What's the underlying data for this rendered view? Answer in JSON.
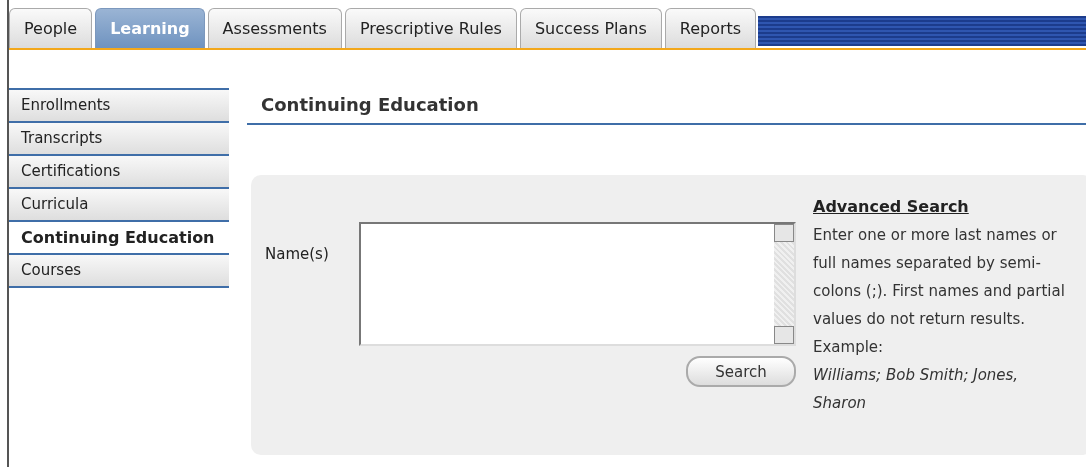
{
  "tabs": [
    {
      "label": "People",
      "selected": false
    },
    {
      "label": "Learning",
      "selected": true
    },
    {
      "label": "Assessments",
      "selected": false
    },
    {
      "label": "Prescriptive Rules",
      "selected": false
    },
    {
      "label": "Success Plans",
      "selected": false
    },
    {
      "label": "Reports",
      "selected": false
    }
  ],
  "sidebar": {
    "items": [
      {
        "label": "Enrollments",
        "selected": false
      },
      {
        "label": "Transcripts",
        "selected": false
      },
      {
        "label": "Certifications",
        "selected": false
      },
      {
        "label": "Curricula",
        "selected": false
      },
      {
        "label": "Continuing Education",
        "selected": true
      },
      {
        "label": "Courses",
        "selected": false
      }
    ]
  },
  "heading": "Continuing Education",
  "search_form": {
    "field_label": "Name(s)",
    "button": "Search"
  },
  "help": {
    "link": "Advanced Search",
    "text": "Enter one or more last names or full names separated by semi-colons (;). First names and partial values do not return results.",
    "example_label": "Example:",
    "example": "Williams; Bob Smith; Jones, Sharon"
  }
}
